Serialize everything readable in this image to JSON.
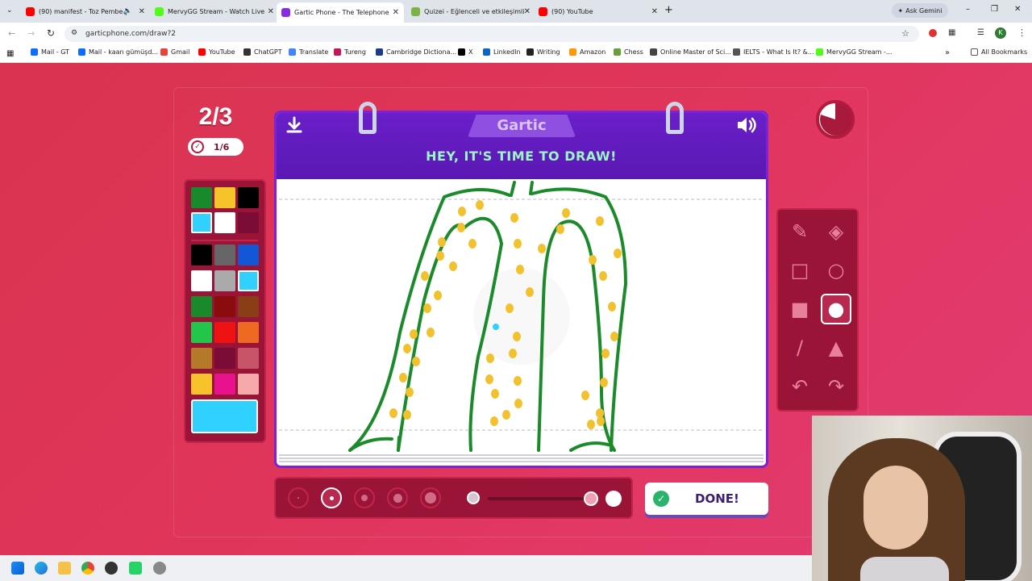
{
  "browser": {
    "tabs": [
      {
        "title": "(90) manifest - Toz Pembe |",
        "color": "#ff0000",
        "active": false
      },
      {
        "title": "MervyGG Stream - Watch Live",
        "color": "#53fc18",
        "active": false
      },
      {
        "title": "Gartic Phone - The Telephone",
        "color": "#8a2be2",
        "active": true
      },
      {
        "title": "Quizei - Eğlenceli ve etkileşimli",
        "color": "#7cb342",
        "active": false
      },
      {
        "title": "(90) YouTube",
        "color": "#ff0000",
        "active": false
      }
    ],
    "gemini_label": "Ask Gemini",
    "url": "garticphone.com/draw?2",
    "bookmarks": [
      "Mail - GT",
      "Mail - kaan gümüşd...",
      "Gmail",
      "YouTube",
      "ChatGPT",
      "Translate",
      "Tureng",
      "Cambridge Dictiona...",
      "X",
      "LinkedIn",
      "Writing",
      "Amazon",
      "Chess",
      "Online Master of Sci...",
      "IELTS - What Is It? &...",
      "MervyGG Stream -..."
    ],
    "all_bookmarks": "All Bookmarks"
  },
  "game": {
    "round": "2/3",
    "done_count": "1/6",
    "logo": "Gartic",
    "heading": "HEY, IT'S TIME TO DRAW!",
    "done_button": "DONE!",
    "palette_primary": [
      "#198a2c",
      "#f7c32a",
      "#000000",
      "#30d0ff",
      "#ffffff",
      "#7a0c36"
    ],
    "palette_grid": [
      "#000000",
      "#666666",
      "#1356d6",
      "#ffffff",
      "#aaaaaa",
      "#30d0ff",
      "#198a2c",
      "#8b0c0c",
      "#8a3e16",
      "#21c64a",
      "#ee1212",
      "#ee6a22",
      "#b47a2a",
      "#7a0c36",
      "#c8546a",
      "#f7c32a",
      "#e8118e",
      "#f7a9a9"
    ],
    "selected_color": "#30d0ff",
    "tools": [
      "pencil-icon",
      "eraser-icon",
      "rectangle-outline-icon",
      "ellipse-outline-icon",
      "rectangle-fill-icon",
      "ellipse-fill-icon",
      "line-icon",
      "bucket-icon",
      "undo-icon",
      "redo-icon"
    ],
    "selected_tool": "ellipse-fill-icon",
    "brush_sizes": 5,
    "selected_brush": 2,
    "opacity": 0.87
  },
  "colors": {
    "accent": "#6b21c8",
    "bg": "#dd3452",
    "ink": "#1a8a2a",
    "dot": "#f2c12e"
  }
}
